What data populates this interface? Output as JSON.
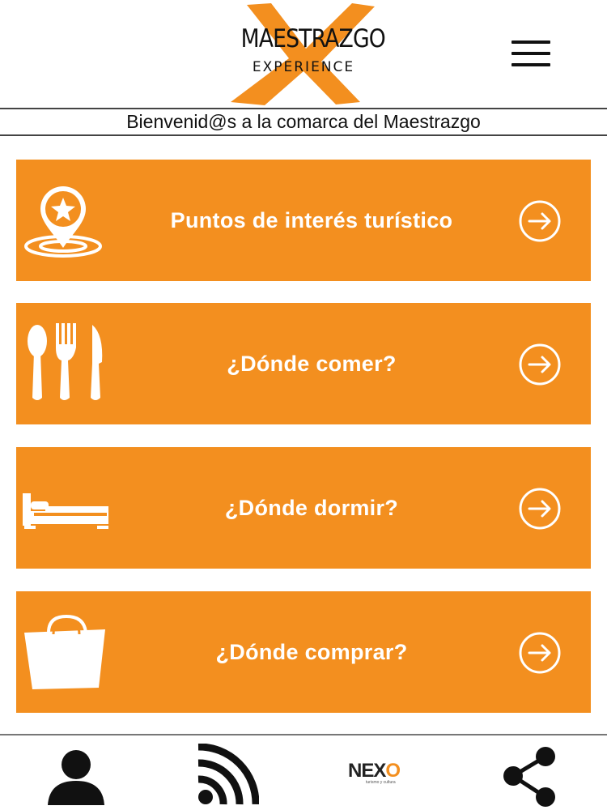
{
  "header": {
    "logo_title": "MAESTRAZGO",
    "logo_subtitle": "EXPERIENCE"
  },
  "welcome_text": "Bienvenid@s a la comarca del Maestrazgo",
  "tiles": [
    {
      "label": "Puntos de interés turístico",
      "icon": "map-pin-star-icon"
    },
    {
      "label": "¿Dónde comer?",
      "icon": "cutlery-icon"
    },
    {
      "label": "¿Dónde dormir?",
      "icon": "bed-icon"
    },
    {
      "label": "¿Dónde comprar?",
      "icon": "shopping-bag-icon"
    }
  ],
  "bottom_nav": {
    "items": [
      "user-icon",
      "rss-feed-icon",
      "nexo-logo",
      "share-icon"
    ],
    "nexo_logo": {
      "text_main": "NEX",
      "text_accent": "O",
      "tagline": "turismo y cultura"
    }
  },
  "colors": {
    "accent": "#f38f1f",
    "text": "#111111",
    "background": "#ffffff"
  }
}
